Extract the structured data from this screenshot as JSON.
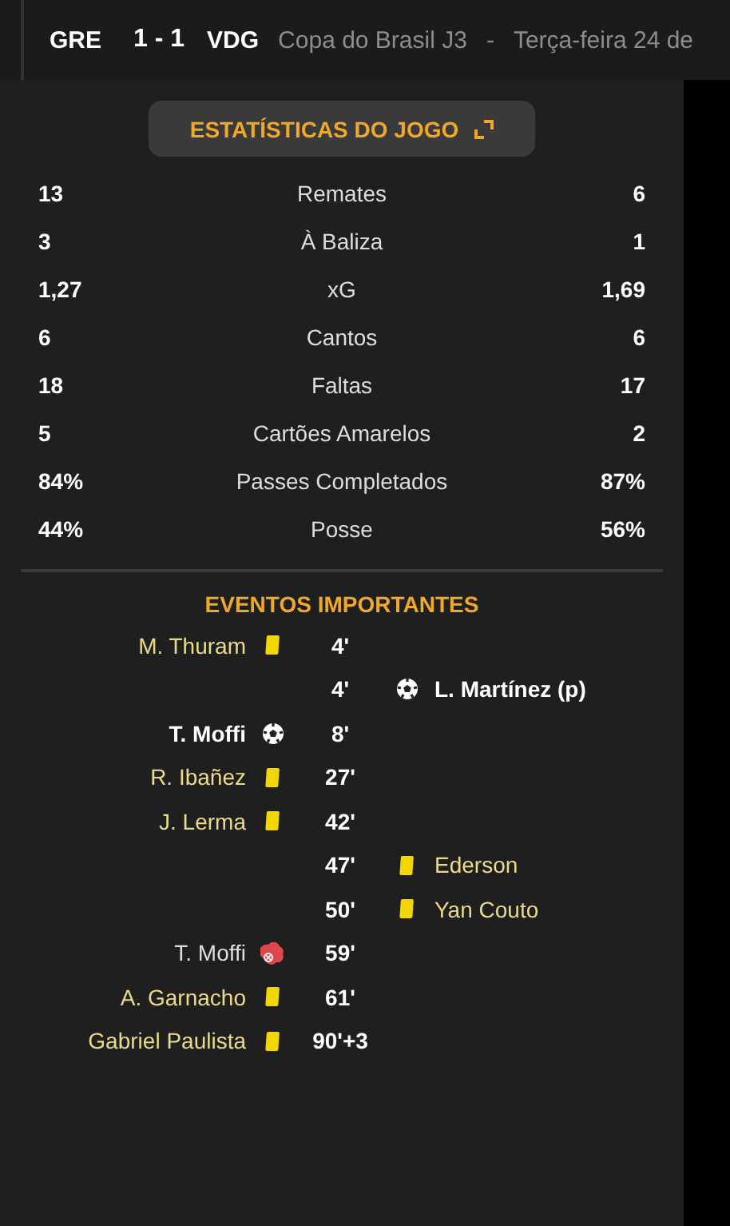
{
  "header": {
    "home": "GRE",
    "score": "1 - 1",
    "away": "VDG",
    "competition": "Copa do Brasil J3",
    "separator": "-",
    "date": "Terça-feira 24 de"
  },
  "stats_button": {
    "label": "ESTATÍSTICAS DO JOGO"
  },
  "stats": [
    {
      "home": "13",
      "label": "Remates",
      "away": "6"
    },
    {
      "home": "3",
      "label": "À Baliza",
      "away": "1"
    },
    {
      "home": "1,27",
      "label": "xG",
      "away": "1,69"
    },
    {
      "home": "6",
      "label": "Cantos",
      "away": "6"
    },
    {
      "home": "18",
      "label": "Faltas",
      "away": "17"
    },
    {
      "home": "5",
      "label": "Cartões Amarelos",
      "away": "2"
    },
    {
      "home": "84%",
      "label": "Passes Completados",
      "away": "87%"
    },
    {
      "home": "44%",
      "label": "Posse",
      "away": "56%"
    }
  ],
  "events_title": "EVENTOS IMPORTANTES",
  "events": [
    {
      "home": {
        "kind": "yellow_card",
        "player": "M. Thuram"
      },
      "minute": "4'"
    },
    {
      "away": {
        "kind": "goal",
        "player": "L. Martínez (p)"
      },
      "minute": "4'"
    },
    {
      "home": {
        "kind": "goal",
        "player": "T. Moffi"
      },
      "minute": "8'"
    },
    {
      "home": {
        "kind": "yellow_card",
        "player": "R. Ibañez"
      },
      "minute": "27'"
    },
    {
      "home": {
        "kind": "yellow_card",
        "player": "J. Lerma"
      },
      "minute": "42'"
    },
    {
      "away": {
        "kind": "yellow_card",
        "player": "Ederson"
      },
      "minute": "47'"
    },
    {
      "away": {
        "kind": "yellow_card",
        "player": "Yan Couto"
      },
      "minute": "50'"
    },
    {
      "home": {
        "kind": "missed_penalty",
        "player": "T. Moffi"
      },
      "minute": "59'"
    },
    {
      "home": {
        "kind": "yellow_card",
        "player": "A. Garnacho"
      },
      "minute": "61'"
    },
    {
      "home": {
        "kind": "yellow_card",
        "player": "Gabriel Paulista"
      },
      "minute": "90'+3"
    }
  ]
}
